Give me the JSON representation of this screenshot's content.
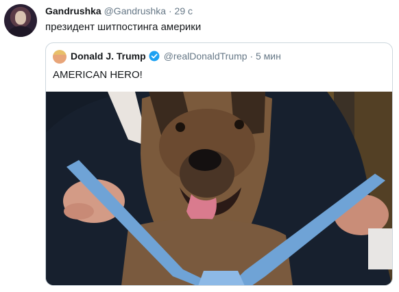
{
  "tweet": {
    "display_name": "Gandrushka",
    "handle": "@Gandrushka",
    "separator": "·",
    "time": "29 с",
    "text": "президент шитпостинга америки"
  },
  "quoted_tweet": {
    "display_name": "Donald J. Trump",
    "verified": true,
    "handle": "@realDonaldTrump",
    "separator": "·",
    "time": "5 мин",
    "text": "AMERICAN HERO!"
  },
  "icons": {
    "avatar": "user-avatar",
    "quoted_avatar": "user-avatar",
    "verified": "verified-badge-icon"
  },
  "colors": {
    "text_primary": "#14171a",
    "text_secondary": "#657786",
    "border": "#ccd6dd",
    "verified": "#1da1f2",
    "ribbon": "#6fa3d6"
  }
}
